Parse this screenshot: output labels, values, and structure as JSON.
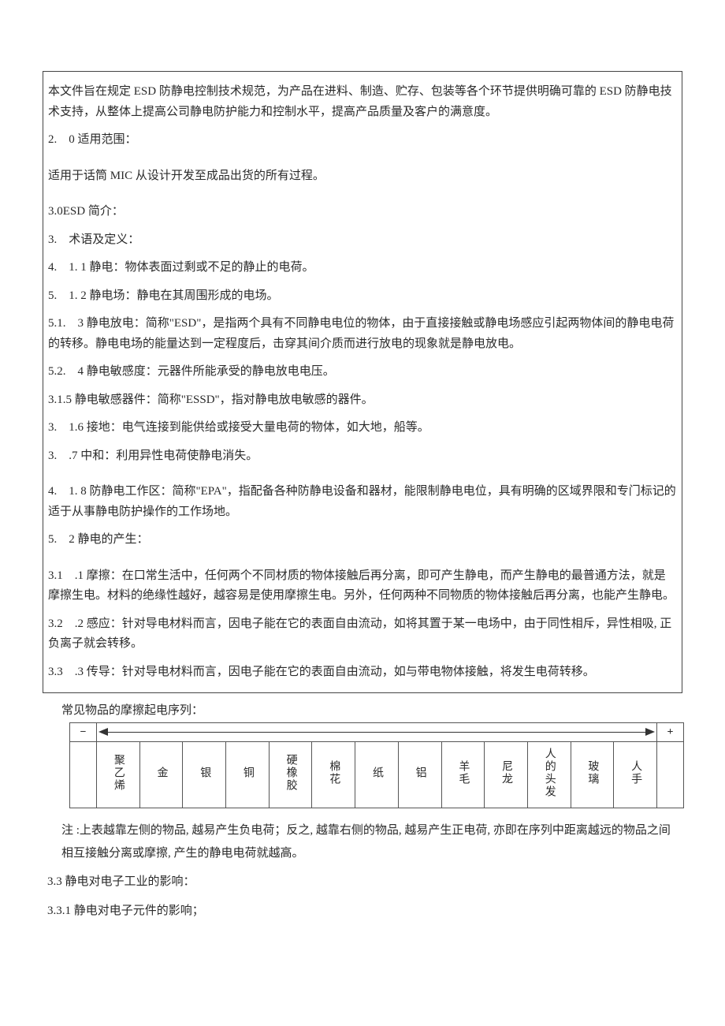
{
  "box": {
    "p1": "本文件旨在规定 ESD 防静电控制技术规范，为产品在进料、制造、贮存、包装等各个环节提供明确可靠的 ESD 防静电技术支持，从整体上提高公司静电防护能力和控制水平，提高产品质量及客户的满意度。",
    "s2_head": "2.　0 适用范围：",
    "s2_body": "适用于话筒 MIC 从设计开发至成品出货的所有过程。",
    "s3_intro": "3.0ESD 简介：",
    "s3_terms": "3.　术语及定义：",
    "d1": "4.　1. 1 静电：物体表面过剩或不足的静止的电荷。",
    "d2": "5.　1. 2 静电场：静电在其周围形成的电场。",
    "d3": "5.1.　3 静电放电：简称\"ESD\"，是指两个具有不同静电电位的物体，由于直接接触或静电场感应引起两物体间的静电电荷的转移。静电电场的能量达到一定程度后，击穿其间介质而进行放电的现象就是静电放电。",
    "d4": "5.2.　4 静电敏感度：元器件所能承受的静电放电电压。",
    "d5": "3.1.5 静电敏感器件：简称\"ESSD\"，指对静电放电敏感的器件。",
    "d6": "3.　1.6 接地：电气连接到能供给或接受大量电荷的物体，如大地，船等。",
    "d7": "3.　.7 中和：利用异性电荷使静电消失。",
    "d8": "4.　1. 8 防静电工作区：简称\"EPA\"，指配备各种防静电设备和器材，能限制静电电位，具有明确的区域界限和专门标记的适于从事静电防护操作的工作场地。",
    "gen_head": "5.　2 静电的产生：",
    "g1": "3.1　.1 摩擦：在口常生活中，任何两个不同材质的物体接触后再分离，即可产生静电，而产生静电的最普通方法，就是摩擦生电。材料的绝缘性越好，越容易是使用摩擦生电。另外，任何两种不同物质的物体接触后再分离，也能产生静电。",
    "g2": "3.2　.2 感应：针对导电材料而言，因电子能在它的表面自由流动，如将其置于某一电场中，由于同性相斥，异性相吸, 正负离子就会转移。",
    "g3": "3.3　.3 传导：针对导电材料而言，因电子能在它的表面自由流动，如与带电物体接触，将发生电荷转移。"
  },
  "tribo": {
    "caption": "常见物品的摩擦起电序列：",
    "minus": "−",
    "plus": "+",
    "items": [
      "聚乙烯",
      "金",
      "银",
      "铜",
      "硬橡胶",
      "棉花",
      "纸",
      "铝",
      "羊毛",
      "尼龙",
      "人的头发",
      "玻璃",
      "人手"
    ],
    "note": "注 :上表越靠左侧的物品, 越易产生负电荷；反之, 越靠右侧的物品, 越易产生正电荷, 亦即在序列中距离越远的物品之间相互接触分离或摩擦, 产生的静电电荷就越高。"
  },
  "after": {
    "s33": "3.3 静电对电子工业的影响：",
    "s331": "3.3.1 静电对电子元件的影响；"
  }
}
